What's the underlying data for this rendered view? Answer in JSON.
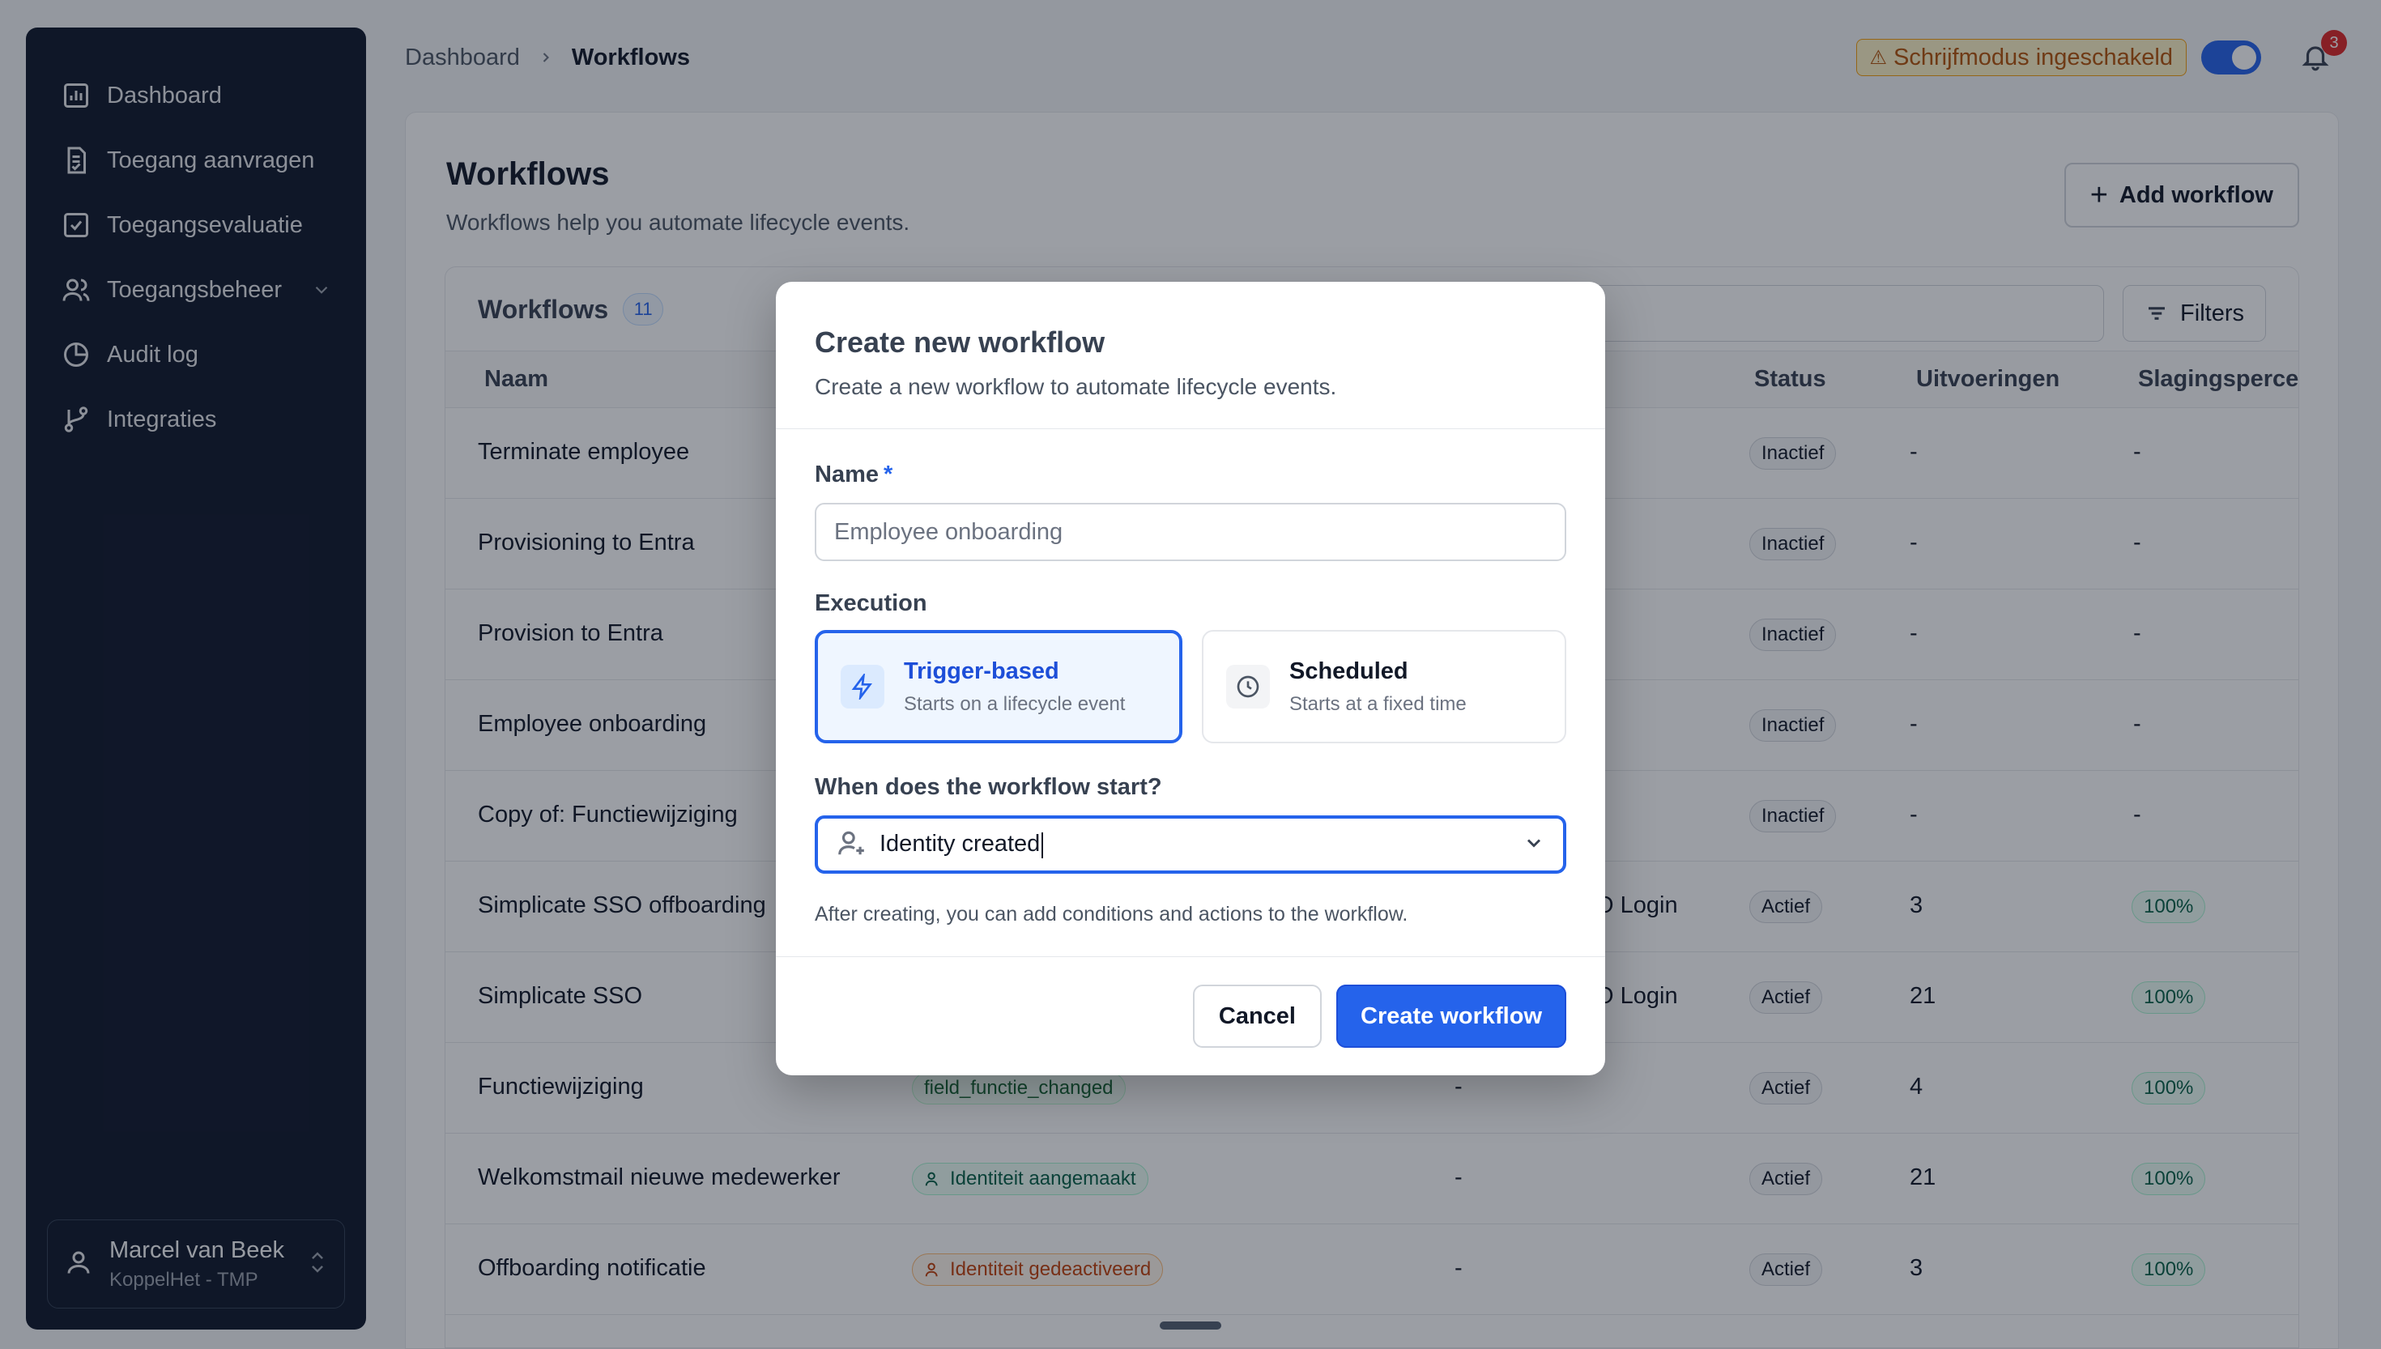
{
  "sidebar": {
    "items": [
      {
        "label": "Dashboard"
      },
      {
        "label": "Toegang aanvragen"
      },
      {
        "label": "Toegangsevaluatie"
      },
      {
        "label": "Toegangsbeheer"
      },
      {
        "label": "Audit log"
      },
      {
        "label": "Integraties"
      }
    ],
    "user": {
      "name": "Marcel van Beek",
      "org": "KoppelHet - TMP"
    }
  },
  "topbar": {
    "breadcrumb": [
      "Dashboard",
      "Workflows"
    ],
    "write_mode": "Schrijfmodus ingeschakeld",
    "notification_count": "3"
  },
  "page": {
    "title": "Workflows",
    "subtitle": "Workflows help you automate lifecycle events.",
    "add_label": "Add workflow"
  },
  "table": {
    "title": "Workflows",
    "count": "11",
    "filters_label": "Filters",
    "columns": {
      "name": "Naam",
      "status": "Status",
      "runs": "Uitvoeringen",
      "success": "Slagingspercen"
    },
    "rows": [
      {
        "name": "Terminate employee",
        "trigger": "",
        "third": "",
        "status": "Inactief",
        "runs": "-",
        "success": "-"
      },
      {
        "name": "Provisioning to Entra",
        "trigger": "",
        "third": "",
        "status": "Inactief",
        "runs": "-",
        "success": "-"
      },
      {
        "name": "Provision to Entra",
        "trigger": "",
        "third": "",
        "status": "Inactief",
        "runs": "-",
        "success": "-"
      },
      {
        "name": "Employee onboarding",
        "trigger": "",
        "third": "",
        "status": "Inactief",
        "runs": "-",
        "success": "-"
      },
      {
        "name": "Copy of: Functiewijziging",
        "trigger": "",
        "third": "",
        "status": "Inactief",
        "runs": "-",
        "success": "-"
      },
      {
        "name": "Simplicate SSO offboarding",
        "trigger": "",
        "third": "O Login",
        "status": "Actief",
        "runs": "3",
        "success": "100%"
      },
      {
        "name": "Simplicate SSO",
        "trigger": "",
        "third": "O Login",
        "status": "Actief",
        "runs": "21",
        "success": "100%"
      },
      {
        "name": "Functiewijziging",
        "trigger": "field_functie_changed",
        "third": "-",
        "status": "Actief",
        "runs": "4",
        "success": "100%"
      },
      {
        "name": "Welkomstmail nieuwe medewerker",
        "trigger": "Identiteit aangemaakt",
        "third": "-",
        "status": "Actief",
        "runs": "21",
        "success": "100%"
      },
      {
        "name": "Offboarding notificatie",
        "trigger": "Identiteit gedeactiveerd",
        "third": "-",
        "status": "Actief",
        "runs": "3",
        "success": "100%"
      }
    ]
  },
  "modal": {
    "title": "Create new workflow",
    "subtitle": "Create a new workflow to automate lifecycle events.",
    "name_label": "Name",
    "required_mark": "*",
    "name_placeholder": "Employee onboarding",
    "execution_label": "Execution",
    "options": [
      {
        "title": "Trigger-based",
        "desc": "Starts on a lifecycle event"
      },
      {
        "title": "Scheduled",
        "desc": "Starts at a fixed time"
      }
    ],
    "start_label": "When does the workflow start?",
    "start_value": "Identity created",
    "hint": "After creating, you can add conditions and actions to the workflow.",
    "cancel_label": "Cancel",
    "create_label": "Create workflow"
  }
}
